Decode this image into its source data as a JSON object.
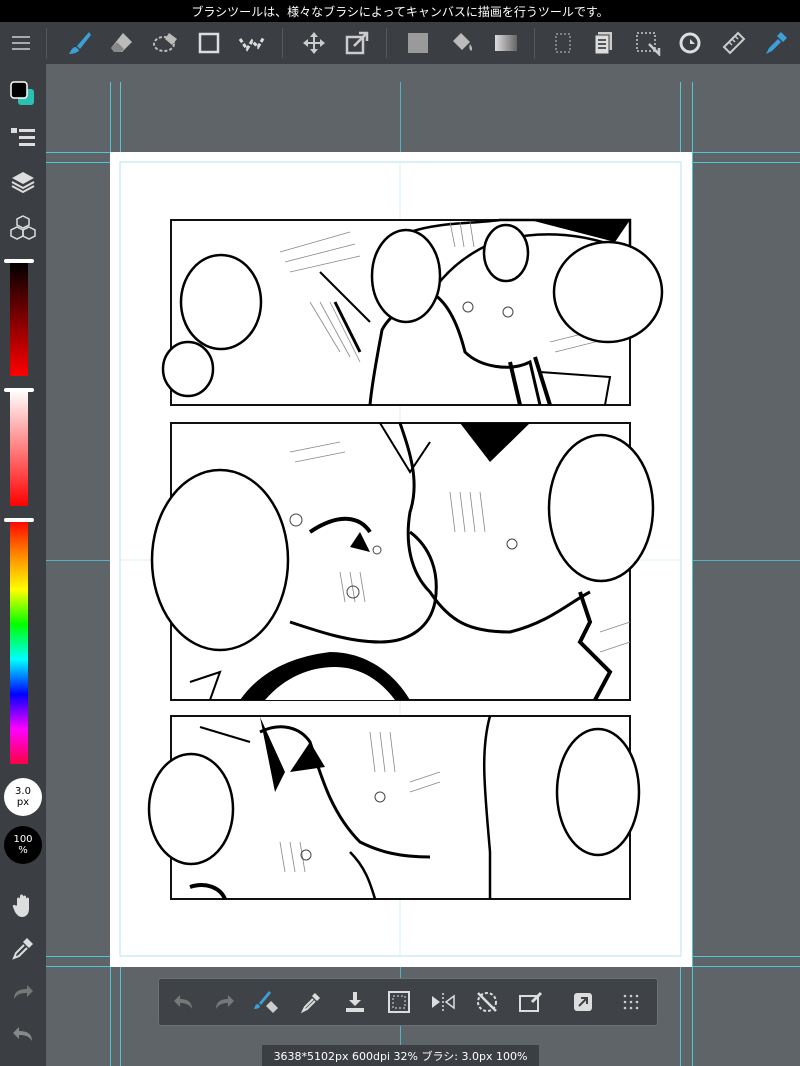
{
  "hint": "ブラシツールは、様々なブラシによってキャンバスに描画を行うツールです。",
  "toolbar": {
    "tools": [
      {
        "name": "menu-icon",
        "active": false
      },
      {
        "name": "brush-icon",
        "active": true
      },
      {
        "name": "eraser-icon",
        "active": false
      },
      {
        "name": "lasso-eraser-icon",
        "active": false
      },
      {
        "name": "shape-icon",
        "active": false
      },
      {
        "name": "magic-wand-icon",
        "active": false
      },
      {
        "name": "move-icon",
        "active": false
      },
      {
        "name": "transform-icon",
        "active": false
      },
      {
        "name": "fill-color-icon",
        "active": false
      },
      {
        "name": "bucket-icon",
        "active": false
      },
      {
        "name": "gradient-icon",
        "active": false
      },
      {
        "name": "selection-icon",
        "active": false
      },
      {
        "name": "text-icon",
        "active": false
      },
      {
        "name": "select-pen-icon",
        "active": false
      },
      {
        "name": "rotate-tool-icon",
        "active": false
      },
      {
        "name": "ruler-icon",
        "active": false
      },
      {
        "name": "dropper-blue-icon",
        "active": true
      }
    ]
  },
  "left_panel": {
    "brush_size": {
      "value": "3.0",
      "unit": "px"
    },
    "opacity": {
      "value": "100",
      "unit": "%"
    }
  },
  "colors": {
    "accent": "#3d9fd6",
    "panel": "#3b3e42",
    "canvas_bg": "#5f6468",
    "guide": "#4fc6d6",
    "primary": "#000000",
    "secondary": "#2cc0b4"
  },
  "bottom_bar": {
    "buttons": [
      "undo-icon",
      "redo-icon",
      "brush-eraser-toggle-icon",
      "eyedropper-icon",
      "save-download-icon",
      "selection-icon",
      "flip-icon",
      "rotate-reset-icon",
      "transform-icon",
      "share-icon",
      "grid-icon"
    ]
  },
  "status": "3638*5102px 600dpi 32% ブラシ: 3.0px 100%"
}
